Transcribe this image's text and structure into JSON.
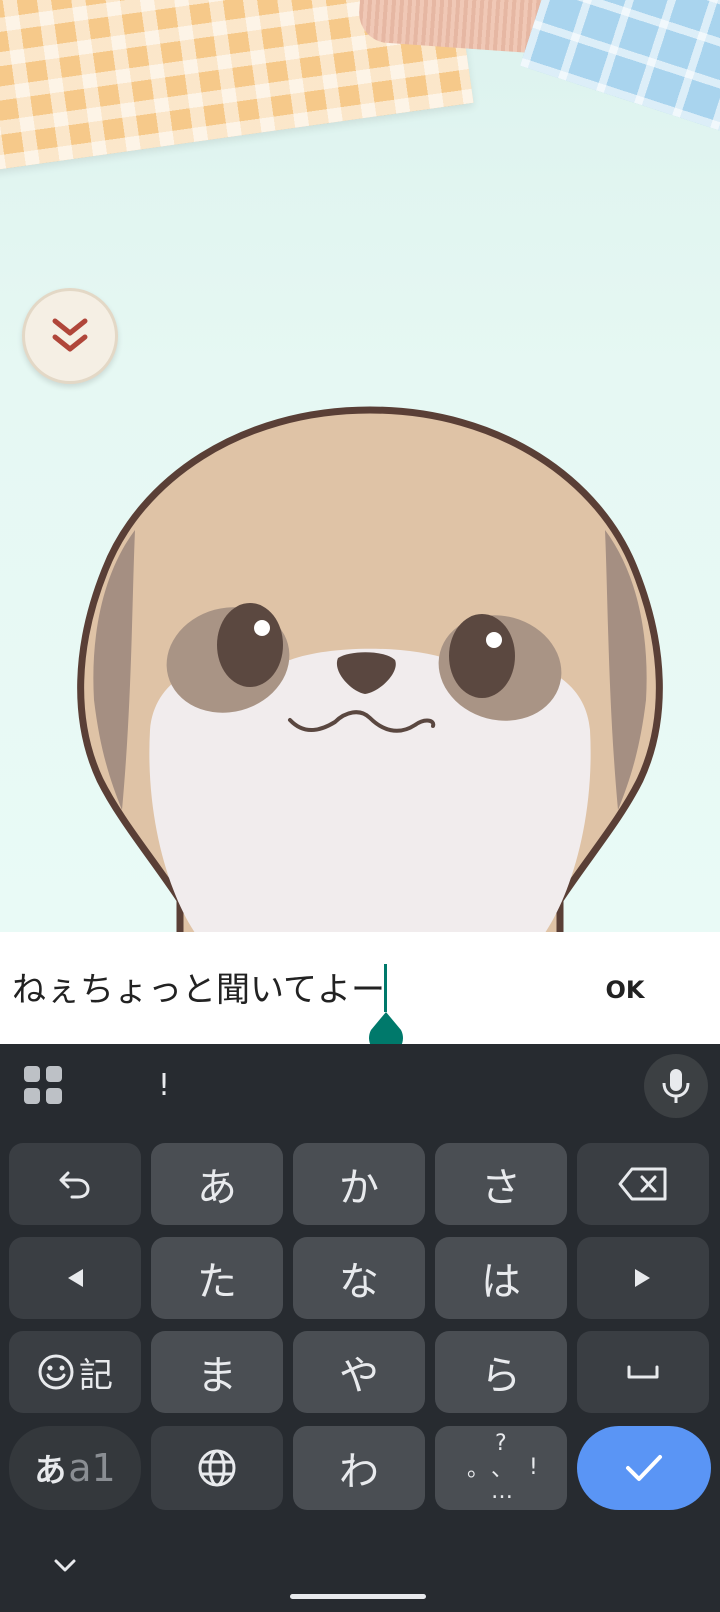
{
  "input": {
    "text": "ねぇちょっと聞いてよー",
    "ok_label": "OK"
  },
  "keyboard": {
    "suggestion": "!",
    "rows": [
      [
        "あ",
        "か",
        "さ"
      ],
      [
        "た",
        "な",
        "は"
      ],
      [
        "ま",
        "や",
        "ら"
      ]
    ],
    "bottom_char": "わ",
    "emoji_label": "記",
    "mode_label_kana": "あ",
    "mode_label_alnum": "a1",
    "punct": [
      "?",
      "。",
      "、",
      "!",
      "…"
    ]
  },
  "colors": {
    "accent": "#00796b",
    "enter": "#5a95f5",
    "keyboard_bg": "#272b30"
  }
}
